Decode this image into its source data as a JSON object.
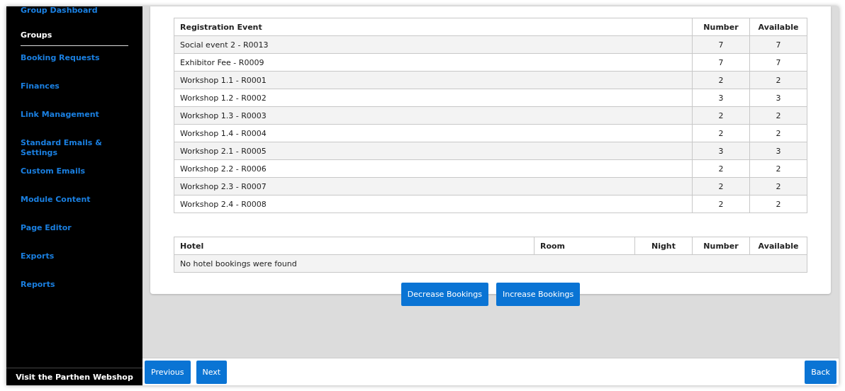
{
  "sidebar": {
    "items": [
      {
        "label": "Group Dashboard",
        "selected": false
      },
      {
        "label": "Groups",
        "selected": true
      },
      {
        "label": "Booking Requests",
        "selected": false
      },
      {
        "label": "Finances",
        "selected": false
      },
      {
        "label": "Link Management",
        "selected": false
      },
      {
        "label": "Standard Emails & Settings",
        "selected": false
      },
      {
        "label": "Custom Emails",
        "selected": false
      },
      {
        "label": "Module Content",
        "selected": false
      },
      {
        "label": "Page Editor",
        "selected": false
      },
      {
        "label": "Exports",
        "selected": false
      },
      {
        "label": "Reports",
        "selected": false
      }
    ],
    "footer_link": "Visit the Parthen Webshop"
  },
  "events_table": {
    "columns": [
      "Registration Event",
      "Number",
      "Available"
    ],
    "rows": [
      [
        "Social event 2 - R0013",
        "7",
        "7"
      ],
      [
        "Exhibitor Fee - R0009",
        "7",
        "7"
      ],
      [
        "Workshop 1.1 - R0001",
        "2",
        "2"
      ],
      [
        "Workshop 1.2 - R0002",
        "3",
        "3"
      ],
      [
        "Workshop 1.3 - R0003",
        "2",
        "2"
      ],
      [
        "Workshop 1.4 - R0004",
        "2",
        "2"
      ],
      [
        "Workshop 2.1 - R0005",
        "3",
        "3"
      ],
      [
        "Workshop 2.2 - R0006",
        "2",
        "2"
      ],
      [
        "Workshop 2.3 - R0007",
        "2",
        "2"
      ],
      [
        "Workshop 2.4 - R0008",
        "2",
        "2"
      ]
    ]
  },
  "hotel_table": {
    "columns": [
      "Hotel",
      "Room",
      "Night",
      "Number",
      "Available"
    ],
    "empty_message": "No hotel bookings were found"
  },
  "actions": [
    "Decrease Bookings",
    "Increase Bookings"
  ],
  "footer": {
    "left_buttons": [
      "Previous",
      "Next"
    ],
    "right_buttons": [
      "Back"
    ]
  }
}
